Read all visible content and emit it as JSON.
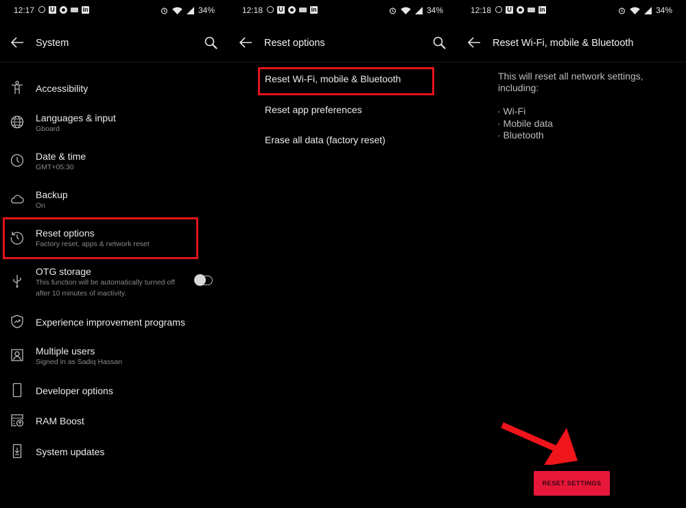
{
  "accent_color": "#e8173a",
  "highlight_color": "#e5141b",
  "panels": [
    {
      "status_bar": {
        "time": "12:17",
        "battery": "34%",
        "notification_icons": [
          "whatsapp-icon",
          "u-app-icon",
          "ring-app-icon",
          "gboard-icon",
          "linkedin-icon"
        ],
        "status_icons": [
          "alarm-icon",
          "wifi-icon",
          "signal-icon"
        ]
      },
      "title": "System",
      "back_icon": "arrow-left-icon",
      "search_icon": "search-icon",
      "items": [
        {
          "label": "Accessibility",
          "sub": "",
          "icon": "accessibility-icon"
        },
        {
          "label": "Languages & input",
          "sub": "Gboard",
          "icon": "globe-icon"
        },
        {
          "label": "Date & time",
          "sub": "GMT+05:30",
          "icon": "clock-icon"
        },
        {
          "label": "Backup",
          "sub": "On",
          "icon": "cloud-icon"
        },
        {
          "label": "Reset options",
          "sub": "Factory reset, apps & network reset",
          "icon": "history-icon",
          "highlighted": true
        },
        {
          "label": "OTG storage",
          "sub": "This function will be automatically turned off",
          "sub2": "after 10 minutes of inactivity.",
          "icon": "usb-icon",
          "toggle": false
        },
        {
          "label": "Experience improvement programs",
          "sub": "",
          "icon": "shield-trend-icon"
        },
        {
          "label": "Multiple users",
          "sub": "Signed in as Sadiq Hassan",
          "icon": "user-icon"
        },
        {
          "label": "Developer options",
          "sub": "",
          "icon": "phone-icon"
        },
        {
          "label": "RAM Boost",
          "sub": "",
          "icon": "ram-boost-icon"
        },
        {
          "label": "System updates",
          "sub": "",
          "icon": "system-update-icon"
        }
      ]
    },
    {
      "status_bar": {
        "time": "12:18",
        "battery": "34%"
      },
      "title": "Reset options",
      "options": [
        {
          "label": "Reset Wi-Fi, mobile & Bluetooth",
          "highlighted": true
        },
        {
          "label": "Reset app preferences"
        },
        {
          "label": "Erase all data (factory reset)"
        }
      ]
    },
    {
      "status_bar": {
        "time": "12:18",
        "battery": "34%"
      },
      "title": "Reset Wi-Fi, mobile & Bluetooth",
      "description_line1": "This will reset all network settings,",
      "description_line2": "including:",
      "bullets": [
        "· Wi-Fi",
        "· Mobile data",
        "· Bluetooth"
      ],
      "reset_button_label": "RESET SETTINGS"
    }
  ]
}
